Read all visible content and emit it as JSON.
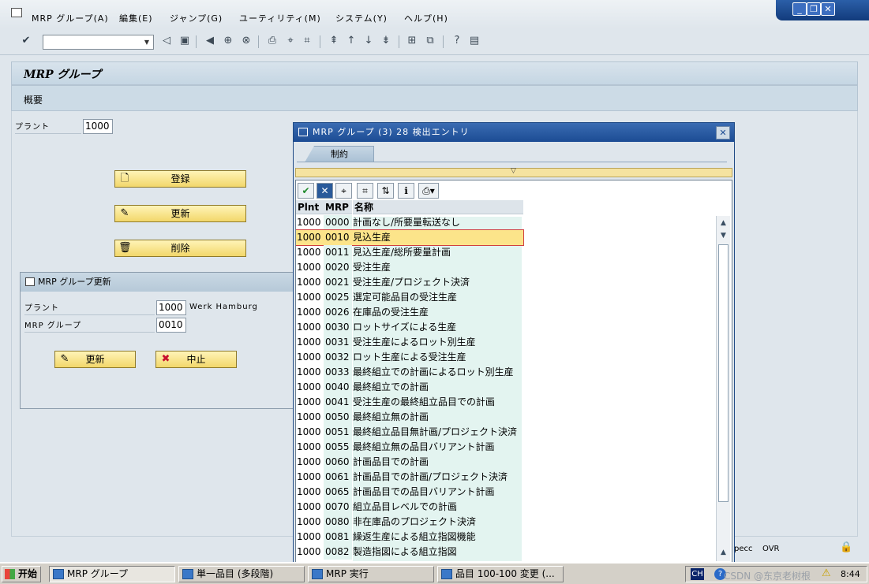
{
  "menubar": {
    "items": [
      "MRP グループ(A)",
      "編集(E)",
      "ジャンプ(G)",
      "ユーティリティ(M)",
      "システム(Y)",
      "ヘルプ(H)"
    ],
    "window_controls": [
      "_",
      "❐",
      "✕"
    ]
  },
  "toolbar": {
    "icons": [
      "enter-icon",
      "back-icon",
      "save-icon",
      "back-nav-icon",
      "exit-icon",
      "cancel-icon",
      "print-icon",
      "find-icon",
      "find-next-icon",
      "first-page-icon",
      "prev-page-icon",
      "next-page-icon",
      "last-page-icon",
      "new-session-icon",
      "shortcut-icon",
      "help-icon",
      "layout-icon"
    ]
  },
  "screen": {
    "title": "MRP グループ",
    "subtitle": "概要",
    "plant_label": "プラント",
    "plant_value": "1000",
    "buttons": {
      "create": "登録",
      "change": "更新",
      "delete": "削除"
    }
  },
  "dialog": {
    "title": "MRP グループ更新",
    "plant_label": "プラント",
    "plant_value": "1000",
    "plant_desc": "Werk Hamburg",
    "group_label": "MRP グループ",
    "group_value": "0010",
    "ok_label": "更新",
    "cancel_label": "中止"
  },
  "popup": {
    "title": "MRP グループ (3)   28 検出エントリ",
    "tab": "制約",
    "close": "✕",
    "columns": [
      "Plnt",
      "MRP",
      "名称"
    ],
    "selected_index": 1,
    "rows": [
      [
        "1000",
        "0000",
        "計画なし/所要量転送なし"
      ],
      [
        "1000",
        "0010",
        "見込生産"
      ],
      [
        "1000",
        "0011",
        "見込生産/総所要量計画"
      ],
      [
        "1000",
        "0020",
        "受注生産"
      ],
      [
        "1000",
        "0021",
        "受注生産/プロジェクト決済"
      ],
      [
        "1000",
        "0025",
        "選定可能品目の受注生産"
      ],
      [
        "1000",
        "0026",
        "在庫品の受注生産"
      ],
      [
        "1000",
        "0030",
        "ロットサイズによる生産"
      ],
      [
        "1000",
        "0031",
        "受注生産によるロット別生産"
      ],
      [
        "1000",
        "0032",
        "ロット生産による受注生産"
      ],
      [
        "1000",
        "0033",
        "最終組立での計画によるロット別生産"
      ],
      [
        "1000",
        "0040",
        "最終組立での計画"
      ],
      [
        "1000",
        "0041",
        "受注生産の最終組立品目での計画"
      ],
      [
        "1000",
        "0050",
        "最終組立無の計画"
      ],
      [
        "1000",
        "0051",
        "最終組立品目無計画/プロジェクト決済"
      ],
      [
        "1000",
        "0055",
        "最終組立無の品目バリアント計画"
      ],
      [
        "1000",
        "0060",
        "計画品目での計画"
      ],
      [
        "1000",
        "0061",
        "計画品目での計画/プロジェクト決済"
      ],
      [
        "1000",
        "0065",
        "計画品目での品目バリアント計画"
      ],
      [
        "1000",
        "0070",
        "組立品目レベルでの計画"
      ],
      [
        "1000",
        "0080",
        "非在庫品のプロジェクト決済"
      ],
      [
        "1000",
        "0081",
        "繰返生産による組立指図機能"
      ],
      [
        "1000",
        "0082",
        "製造指図による組立指図"
      ]
    ]
  },
  "statusbar": {
    "system": "pecc",
    "mode": "OVR"
  },
  "taskbar": {
    "start": "开始",
    "tasks": [
      "MRP グループ",
      "単一品目 (多段階)",
      "MRP 実行",
      "品目 100-100 変更 (..."
    ],
    "tray_lang": "CH",
    "watermark": "CSDN @东京老树根",
    "clock": "8:44"
  }
}
